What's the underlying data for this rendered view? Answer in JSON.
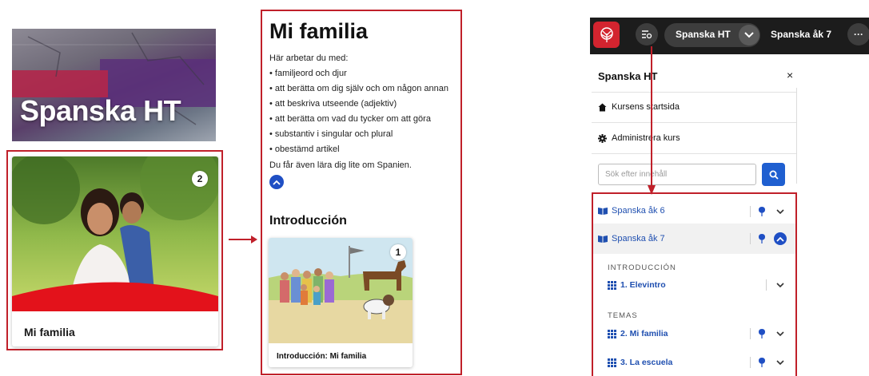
{
  "banner": {
    "title": "Spanska HT"
  },
  "card": {
    "title": "Mi familia",
    "badge": "2"
  },
  "module": {
    "title": "Mi familia",
    "intro_text": "Här arbetar du med:",
    "bullets": [
      "• familjeord och djur",
      "• att berätta om dig själv och om någon annan",
      "• att beskriva utseende (adjektiv)",
      "• att berätta om vad du tycker om att göra",
      "• substantiv i singular och plural",
      "• obestämd artikel"
    ],
    "outro_text": "Du får även lära dig lite om Spanien.",
    "section_heading": "Introducción",
    "intro_card": {
      "label": "Introducción: Mi familia",
      "badge": "1"
    }
  },
  "topbar": {
    "course_selected": "Spanska HT",
    "course_next": "Spanska åk 7",
    "more": "···"
  },
  "sidebar": {
    "header": "Spanska HT",
    "close": "×",
    "links": [
      {
        "label": "Kursens startsida",
        "icon": "home-icon"
      },
      {
        "label": "Administrera kurs",
        "icon": "gear-icon"
      }
    ],
    "search_placeholder": "Sök efter innehåll",
    "courses": [
      {
        "label": "Spanska åk 6",
        "expanded": false
      },
      {
        "label": "Spanska åk 7",
        "expanded": true
      }
    ],
    "sections": [
      {
        "label": "INTRODUCCIÓN",
        "lessons": [
          {
            "label": "1. Elevintro",
            "pinned": false
          }
        ]
      },
      {
        "label": "TEMAS",
        "lessons": [
          {
            "label": "2. Mi familia",
            "pinned": true
          },
          {
            "label": "3. La escuela",
            "pinned": true
          }
        ]
      }
    ]
  },
  "colors": {
    "highlight": "#c0202a",
    "accent": "#1f4fc4",
    "link": "#1f4fb0",
    "topbar": "#1c1c1c",
    "logo": "#d3242f"
  }
}
